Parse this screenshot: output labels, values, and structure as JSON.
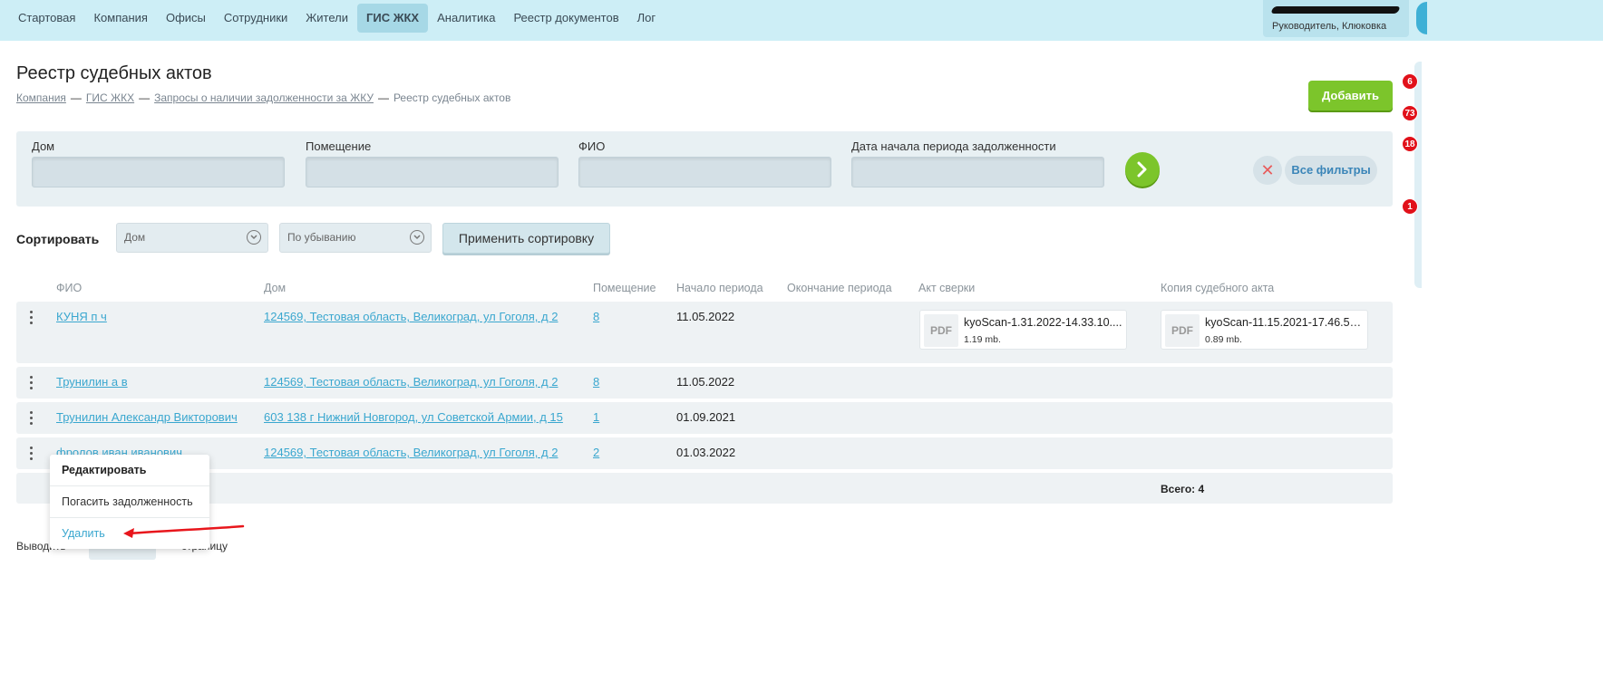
{
  "nav": {
    "items": [
      {
        "label": "Стартовая"
      },
      {
        "label": "Компания"
      },
      {
        "label": "Офисы"
      },
      {
        "label": "Сотрудники"
      },
      {
        "label": "Жители"
      },
      {
        "label": "ГИС ЖКХ",
        "active": true
      },
      {
        "label": "Аналитика"
      },
      {
        "label": "Реестр документов"
      },
      {
        "label": "Лог"
      }
    ]
  },
  "user": {
    "role": "Руководитель, Клюковка"
  },
  "side_badges": [
    "6",
    "73",
    "18",
    "1"
  ],
  "header": {
    "title": "Реестр судебных актов",
    "breadcrumb": [
      "Компания",
      "ГИС ЖКХ",
      "Запросы о наличии задолженности за ЖКУ"
    ],
    "breadcrumb_current": "Реестр судебных актов",
    "breadcrumb_sep": "—",
    "add_label": "Добавить"
  },
  "filters": {
    "house_label": "Дом",
    "room_label": "Помещение",
    "fio_label": "ФИО",
    "debt_start_label": "Дата начала периода задолженности",
    "all_filters_label": "Все фильтры",
    "clear_symbol": "✕"
  },
  "sort": {
    "label": "Сортировать",
    "field_value": "Дом",
    "order_value": "По убыванию",
    "apply_label": "Применить сортировку"
  },
  "table": {
    "headers": {
      "fio": "ФИО",
      "house": "Дом",
      "room": "Помещение",
      "start": "Начало периода",
      "end": "Окончание периода",
      "act": "Акт сверки",
      "copy": "Копия судебного акта"
    },
    "rows": [
      {
        "fio": "КУНЯ п ч",
        "house": "124569, Тестовая область, Великоград, ул Гоголя, д 2",
        "room": "8",
        "start": "11.05.2022"
      },
      {
        "fio": "Трунилин а в",
        "house": "124569, Тестовая область, Великоград, ул Гоголя, д 2",
        "room": "8",
        "start": "11.05.2022"
      },
      {
        "fio": "Трунилин Александр Викторович",
        "house": "603 138 г Нижний Новгород, ул Советской Армии, д 15",
        "room": "1",
        "start": "01.09.2021"
      },
      {
        "fio": "фролов иван иванович",
        "house": "124569, Тестовая область, Великоград, ул Гоголя, д 2",
        "room": "2",
        "start": "01.03.2022"
      }
    ],
    "files": {
      "act": {
        "thumb": "PDF",
        "name": "kyoScan-1.31.2022-14.33.10....",
        "size": "1.19 mb."
      },
      "copy": {
        "thumb": "PDF",
        "name": "kyoScan-11.15.2021-17.46.53...",
        "size": "0.89 mb."
      }
    },
    "total": "Всего: 4"
  },
  "pagination": {
    "label": "Выводить",
    "suffix": "страницу"
  },
  "context_menu": {
    "edit": "Редактировать",
    "repay": "Погасить задолженность",
    "delete": "Удалить"
  },
  "colors": {
    "accent": "#3aa7cf",
    "add_button": "#7cc52b",
    "delete": "#3aa7cf",
    "annotation_arrow": "#e8161c"
  }
}
